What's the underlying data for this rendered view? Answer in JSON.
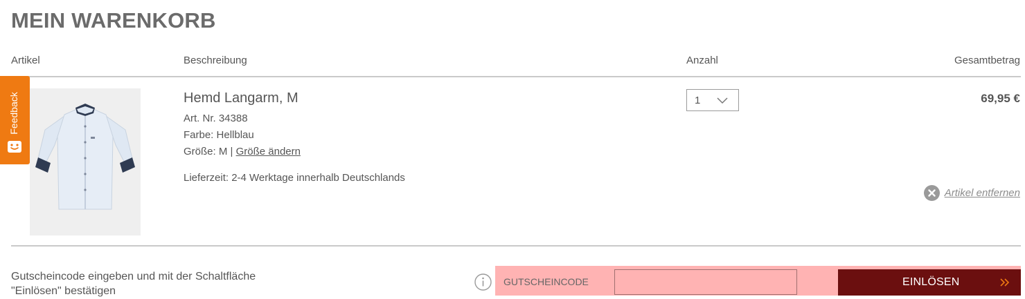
{
  "page": {
    "title": "MEIN WARENKORB"
  },
  "columns": {
    "artikel": "Artikel",
    "beschreibung": "Beschreibung",
    "anzahl": "Anzahl",
    "gesamtbetrag": "Gesamtbetrag"
  },
  "item": {
    "name": "Hemd Langarm, M",
    "art_nr": "Art. Nr. 34388",
    "farbe": "Farbe: Hellblau",
    "groesse_prefix": "Größe: M | ",
    "groesse_link": "Größe ändern",
    "lieferzeit": "Lieferzeit: 2-4 Werktage innerhalb Deutschlands",
    "quantity": "1",
    "price": "69,95 €",
    "remove_label": "Artikel entfernen",
    "image_icon": "shirt-image"
  },
  "feedback": {
    "label": "Feedback",
    "icon": "smiley-icon",
    "color": "#ef7a12"
  },
  "coupon": {
    "hint": "Gutscheincode eingeben und mit der Schaltfläche \"Einlösen\" bestätigen",
    "label": "GUTSCHEINCODE",
    "input_value": "",
    "button_label": "EINLÖSEN",
    "bar_color": "#ffb3b3",
    "button_color": "#6b0f0f"
  }
}
